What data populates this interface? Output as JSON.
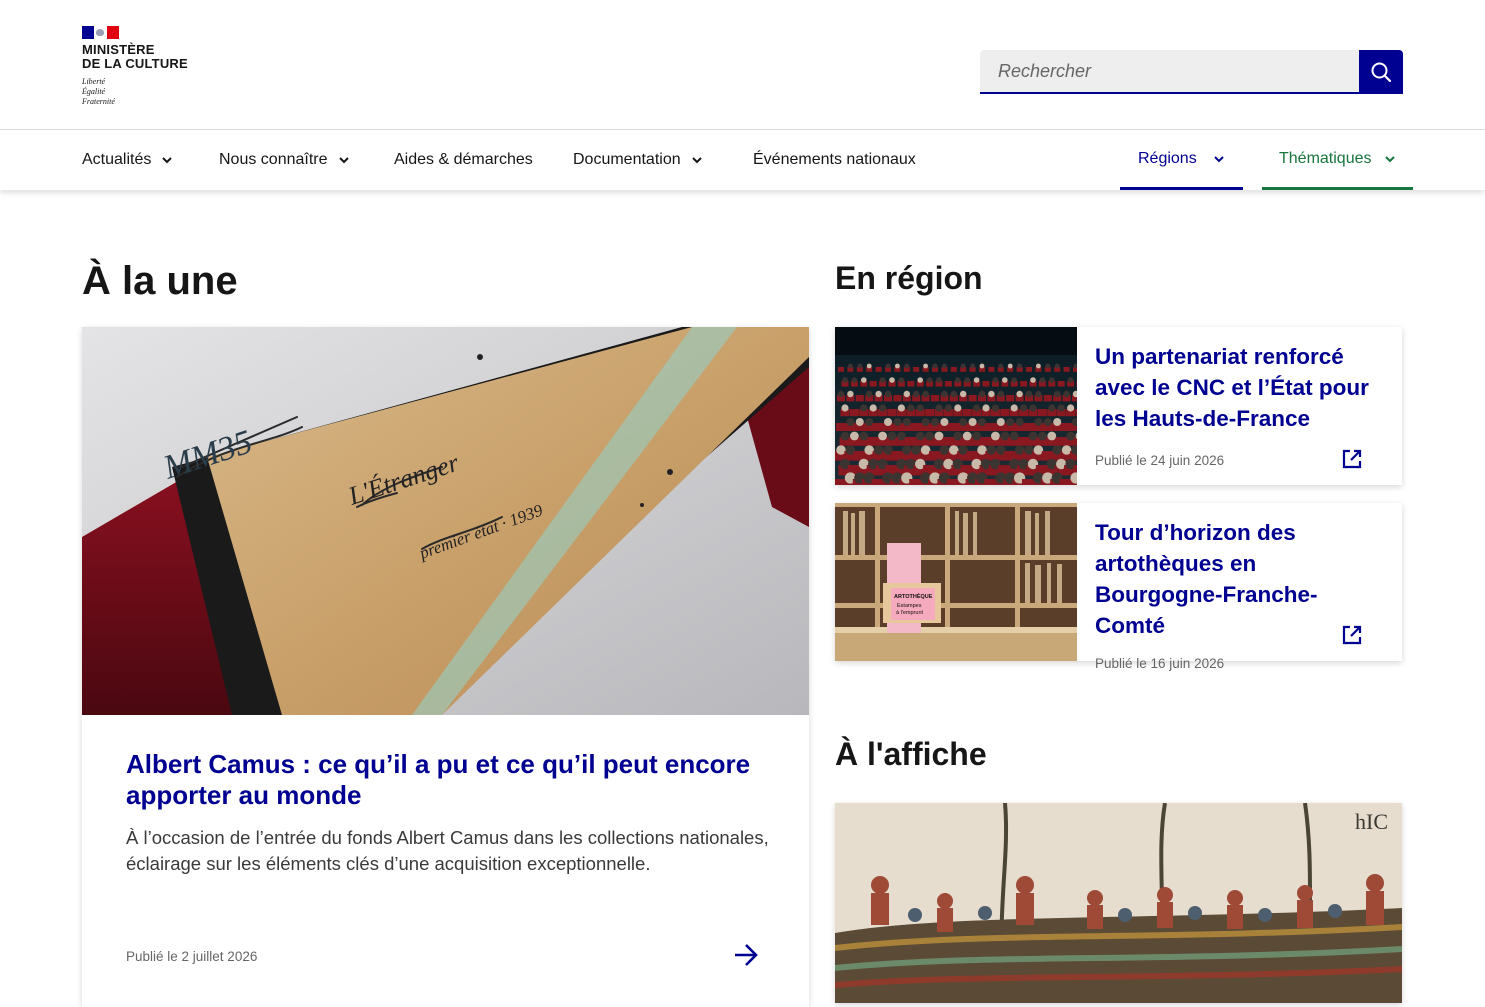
{
  "header": {
    "logo": {
      "title_line1": "MINISTÈRE",
      "title_line2": "DE LA CULTURE",
      "motto_line1": "Liberté",
      "motto_line2": "Égalité",
      "motto_line3": "Fraternité"
    },
    "search": {
      "placeholder": "Rechercher",
      "value": "",
      "button_icon": "search-icon"
    }
  },
  "nav": {
    "items": [
      {
        "label": "Actualités",
        "has_dropdown": true
      },
      {
        "label": "Nous connaître",
        "has_dropdown": true
      },
      {
        "label": "Aides & démarches",
        "has_dropdown": false
      },
      {
        "label": "Documentation",
        "has_dropdown": true
      },
      {
        "label": "Événements nationaux",
        "has_dropdown": false
      }
    ],
    "regions": {
      "label": "Régions",
      "color": "#000091"
    },
    "themes": {
      "label": "Thématiques",
      "color": "#18753c"
    }
  },
  "sections": {
    "une": "À la une",
    "region": "En région",
    "affiche": "À l'affiche"
  },
  "main_article": {
    "title": "Albert Camus : ce qu’il a pu et ce qu’il peut encore apporter au monde",
    "description": "À l’occasion de l’entrée du fonds Albert Camus dans les collections nationales, éclairage sur les éléments clés d’une acquisition exceptionnelle.",
    "date": "Publié le 2 juillet 2026",
    "image_text": {
      "cote": "MM35",
      "title": "L'Étranger",
      "sub": "premier état · 1939"
    }
  },
  "region_articles": [
    {
      "title": "Un partenariat renforcé avec le CNC et l’État pour les Hauts-de-France",
      "date": "Publié le 24 juin 2026"
    },
    {
      "title": "Tour d’horizon des artothèques en Bourgogne-Franche-Comté",
      "date": "Publié le 16 juin 2026",
      "image_text": {
        "line1": "ARTOTHÈQUE",
        "line2": "Estampes",
        "line3": "à l'emprunt"
      }
    }
  ],
  "affiche": {
    "image_text": "hIC"
  },
  "colors": {
    "primary": "#000091",
    "green": "#18753c",
    "text": "#161616",
    "muted": "#666666"
  }
}
